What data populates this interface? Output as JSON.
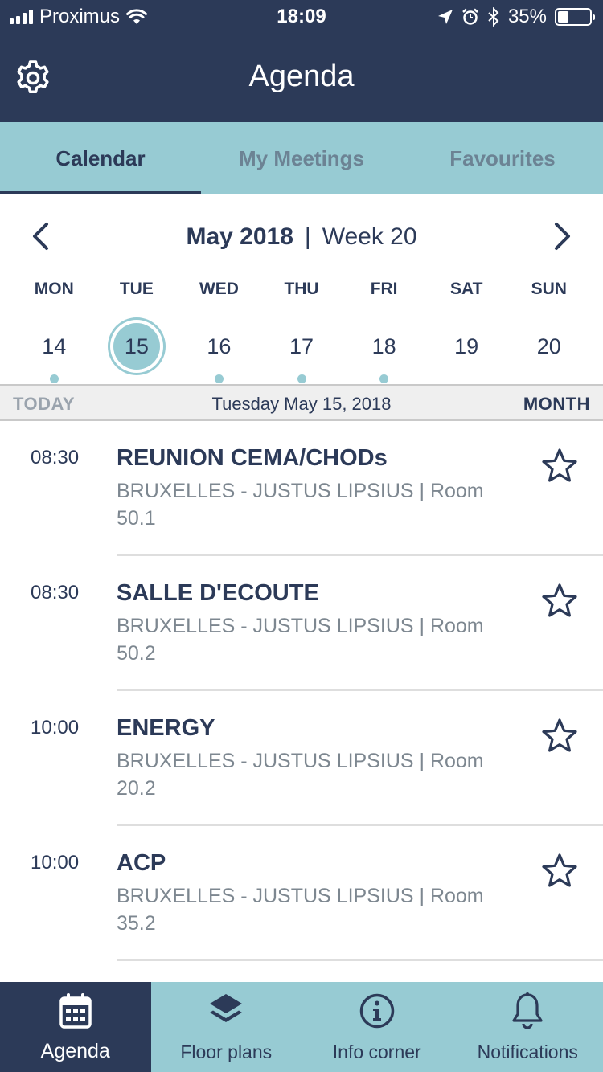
{
  "status_bar": {
    "carrier": "Proximus",
    "time": "18:09",
    "battery": "35%",
    "battery_level": 0.35
  },
  "header": {
    "title": "Agenda",
    "settings_icon": "gear-icon"
  },
  "tabs": [
    {
      "label": "Calendar",
      "active": true
    },
    {
      "label": "My Meetings",
      "active": false
    },
    {
      "label": "Favourites",
      "active": false
    }
  ],
  "week_nav": {
    "month": "May 2018",
    "separator": "|",
    "week": "Week 20"
  },
  "days": [
    {
      "name": "MON",
      "date": "14",
      "has_events": true,
      "selected": false
    },
    {
      "name": "TUE",
      "date": "15",
      "has_events": false,
      "selected": true
    },
    {
      "name": "WED",
      "date": "16",
      "has_events": true,
      "selected": false
    },
    {
      "name": "THU",
      "date": "17",
      "has_events": true,
      "selected": false
    },
    {
      "name": "FRI",
      "date": "18",
      "has_events": true,
      "selected": false
    },
    {
      "name": "SAT",
      "date": "19",
      "has_events": false,
      "selected": false
    },
    {
      "name": "SUN",
      "date": "20",
      "has_events": false,
      "selected": false
    }
  ],
  "today_bar": {
    "today_label": "TODAY",
    "date": "Tuesday May 15, 2018",
    "month_label": "MONTH"
  },
  "meetings": [
    {
      "time": "08:30",
      "title": "REUNION CEMA/CHODs",
      "location": "BRUXELLES - JUSTUS LIPSIUS | Room 50.1"
    },
    {
      "time": "08:30",
      "title": "SALLE D'ECOUTE",
      "location": "BRUXELLES - JUSTUS LIPSIUS | Room 50.2"
    },
    {
      "time": "10:00",
      "title": "ENERGY",
      "location": "BRUXELLES - JUSTUS LIPSIUS | Room 20.2"
    },
    {
      "time": "10:00",
      "title": "ACP",
      "location": "BRUXELLES - JUSTUS LIPSIUS | Room 35.2"
    }
  ],
  "bottom_nav": [
    {
      "label": "Agenda",
      "icon": "calendar-icon",
      "active": true
    },
    {
      "label": "Floor plans",
      "icon": "layers-icon",
      "active": false
    },
    {
      "label": "Info corner",
      "icon": "info-icon",
      "active": false
    },
    {
      "label": "Notifications",
      "icon": "bell-icon",
      "active": false
    }
  ],
  "colors": {
    "navy": "#2c3a58",
    "teal": "#97cbd3",
    "gray_text": "#7d8790"
  }
}
